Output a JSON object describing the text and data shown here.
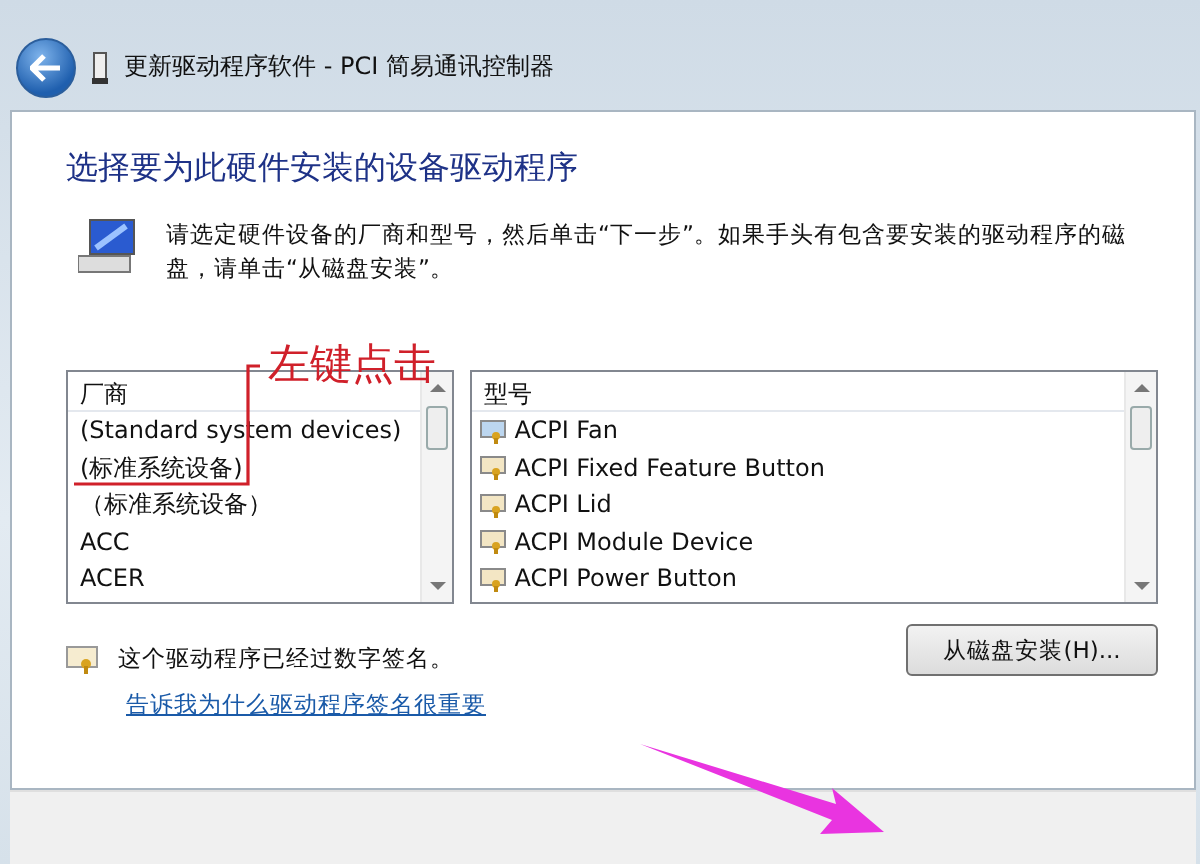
{
  "window": {
    "title": "更新驱动程序软件 - PCI 简易通讯控制器"
  },
  "heading": "选择要为此硬件安装的设备驱动程序",
  "instructions": "请选定硬件设备的厂商和型号，然后单击“下一步”。如果手头有包含要安装的驱动程序的磁盘，请单击“从磁盘安装”。",
  "annotation": {
    "label": "左键点击"
  },
  "manufacturer_list": {
    "header": "厂商",
    "items": [
      "(Standard system devices)",
      "(标准系统设备)",
      "（标准系统设备）",
      "ACC",
      "ACER"
    ]
  },
  "model_list": {
    "header": "型号",
    "items": [
      "ACPI Fan",
      "ACPI Fixed Feature Button",
      "ACPI Lid",
      "ACPI Module Device",
      "ACPI Power Button"
    ]
  },
  "signature_note": "这个驱动程序已经过数字签名。",
  "help_link": "告诉我为什么驱动程序签名很重要",
  "buttons": [
    "从磁盘安装(H)..."
  ]
}
